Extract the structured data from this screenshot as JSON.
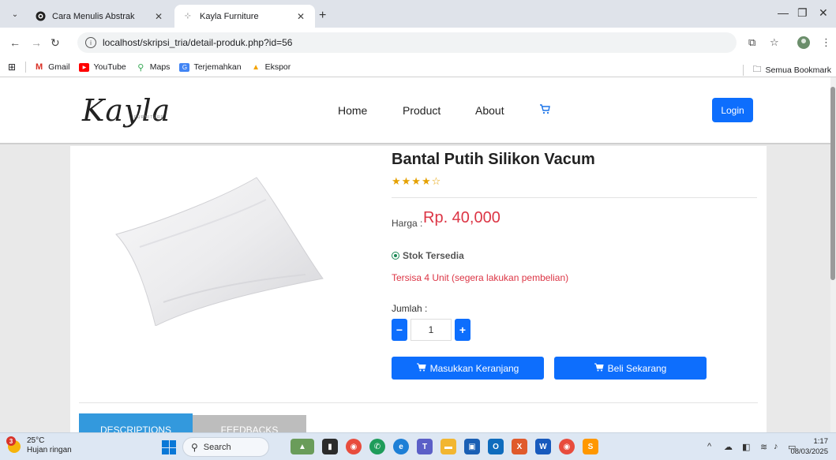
{
  "browser": {
    "tabs": [
      {
        "title": "Cara Menulis Abstrak"
      },
      {
        "title": "Kayla Furniture"
      }
    ],
    "url": "localhost/skripsi_tria/detail-produk.php?id=56",
    "bookmarks": [
      {
        "label": "Gmail",
        "icon": "gmail-icon"
      },
      {
        "label": "YouTube",
        "icon": "youtube-icon"
      },
      {
        "label": "Maps",
        "icon": "maps-icon"
      },
      {
        "label": "Terjemahkan",
        "icon": "translate-icon"
      },
      {
        "label": "Ekspor",
        "icon": "export-icon"
      }
    ],
    "all_bookmarks": "Semua Bookmark"
  },
  "site": {
    "logo": "Kayla",
    "logo_sub": "FURNITURE",
    "nav": [
      "Home",
      "Product",
      "About"
    ],
    "login": "Login"
  },
  "product": {
    "name": "Bantal Putih Silikon Vacum",
    "rating": 4,
    "rating_max": 5,
    "stars": "★★★★☆",
    "price_label": "Harga :",
    "price": "Rp. 40,000",
    "stock_status": "Stok Tersedia",
    "remaining": "Tersisa 4 Unit (segera lakukan pembelian)",
    "quantity_label": "Jumlah :",
    "quantity": "1",
    "add_to_cart": "Masukkan Keranjang",
    "buy_now": "Beli Sekarang",
    "tabs": [
      "DESCRIPTIONS",
      "FEEDBACKS"
    ]
  },
  "taskbar": {
    "weather_temp": "25°C",
    "weather_desc": "Hujan ringan",
    "weather_badge": "3",
    "search": "Search",
    "time": "1:17",
    "date": "08/03/2025"
  },
  "colors": {
    "primary": "#0d6efd",
    "price": "#dc3545",
    "stars": "#e5a100",
    "stock": "#198754",
    "tab_active": "#3399dd"
  }
}
